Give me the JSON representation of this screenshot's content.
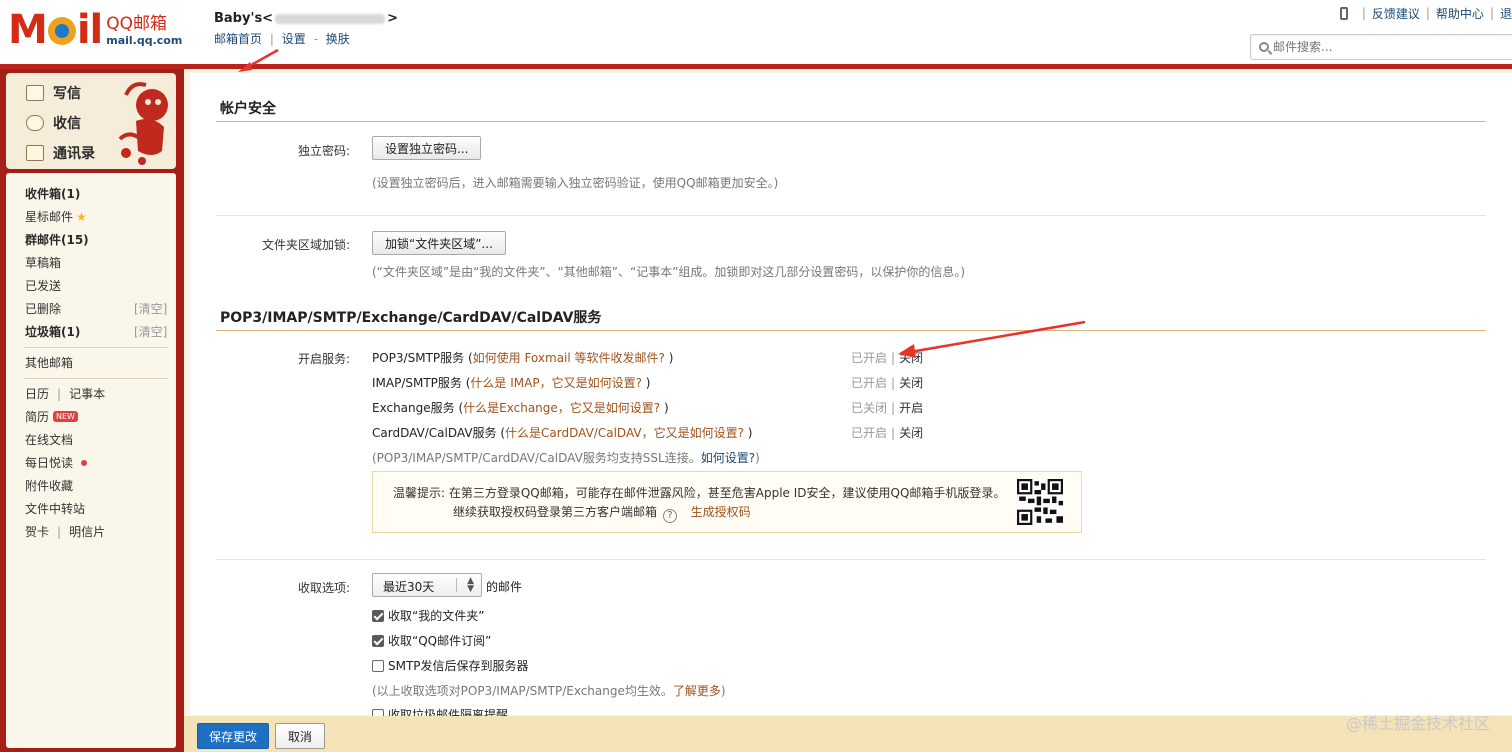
{
  "logo": {
    "brand": "MOIL",
    "cn": "QQ邮箱",
    "url": "mail.qq.com"
  },
  "account": {
    "name_prefix": "Baby's<",
    "name_suffix": ">"
  },
  "header_links": {
    "home": "邮箱首页",
    "settings": "设置",
    "skin": "换肤",
    "sep1": "|",
    "sep2": "-"
  },
  "top_right": {
    "feedback": "反馈建议",
    "help": "帮助中心",
    "more": "退",
    "sep": "|"
  },
  "search": {
    "placeholder": "邮件搜索..."
  },
  "quick_actions": {
    "compose": "写信",
    "inbox": "收信",
    "contacts": "通讯录"
  },
  "folders": {
    "inbox": "收件箱(1)",
    "starred": "星标邮件",
    "groups": "群邮件(15)",
    "drafts": "草稿箱",
    "sent": "已发送",
    "deleted": "已删除",
    "spam": "垃圾箱(1)",
    "clear": "[清空]",
    "other": "其他邮箱",
    "calendar": "日历",
    "notes": "记事本",
    "resume": "简历",
    "new_badge": "NEW",
    "online_docs": "在线文档",
    "daily_read": "每日悦读",
    "attachments": "附件收藏",
    "file_transfer": "文件中转站",
    "cards": "贺卡",
    "postcards": "明信片",
    "sep": "|"
  },
  "account_security": {
    "title": "帐户安全",
    "standalone_pwd_label": "独立密码:",
    "standalone_pwd_button": "设置独立密码...",
    "standalone_pwd_hint": "(设置独立密码后，进入邮箱需要输入独立密码验证，使用QQ邮箱更加安全。)",
    "folder_lock_label": "文件夹区域加锁:",
    "folder_lock_button": "加锁“文件夹区域”...",
    "folder_lock_hint": "(“文件夹区域”是由“我的文件夹”、“其他邮箱”、“记事本”组成。加锁即对这几部分设置密码，以保护你的信息。)"
  },
  "services": {
    "title": "POP3/IMAP/SMTP/Exchange/CardDAV/CalDAV服务",
    "enable_label": "开启服务:",
    "items": [
      {
        "name": "POP3/SMTP服务",
        "question": "如何使用 Foxmail 等软件收发邮件?",
        "status": "已开启",
        "action": "关闭"
      },
      {
        "name": "IMAP/SMTP服务",
        "question": "什么是 IMAP，它又是如何设置?",
        "status": "已开启",
        "action": "关闭"
      },
      {
        "name": "Exchange服务",
        "question": "什么是Exchange，它又是如何设置?",
        "status": "已关闭",
        "action": "开启"
      },
      {
        "name": "CardDAV/CalDAV服务",
        "question": "什么是CardDAV/CalDAV，它又是如何设置?",
        "status": "已开启",
        "action": "关闭"
      }
    ],
    "ssl_hint": "(POP3/IMAP/SMTP/CardDAV/CalDAV服务均支持SSL连接。",
    "ssl_link": "如何设置?",
    "ssl_close": ")",
    "tip_line1": "温馨提示: 在第三方登录QQ邮箱，可能存在邮件泄露风险，甚至危害Apple ID安全，建议使用QQ邮箱手机版登录。",
    "tip_line2": "继续获取授权码登录第三方客户端邮箱",
    "tip_gen": "生成授权码"
  },
  "receive": {
    "label": "收取选项:",
    "range": "最近30天",
    "suffix": "的邮件",
    "options": [
      {
        "label": "收取“我的文件夹”",
        "checked": true
      },
      {
        "label": "收取“QQ邮件订阅”",
        "checked": true
      },
      {
        "label": "SMTP发信后保存到服务器",
        "checked": false
      }
    ],
    "hint": "(以上收取选项对POP3/IMAP/SMTP/Exchange均生效。",
    "hint_link": "了解更多",
    "hint_close": ")",
    "spam_option": "收取垃圾邮件隔离提醒"
  },
  "footer": {
    "save": "保存更改",
    "cancel": "取消"
  },
  "watermark": "@稀土掘金技术社区",
  "colors": {
    "brand_red": "#b9231b",
    "link": "#1b4a77",
    "accent_brown": "#a1521b",
    "primary_button": "#1e6fc2",
    "annotation_arrow": "#e8332a"
  }
}
